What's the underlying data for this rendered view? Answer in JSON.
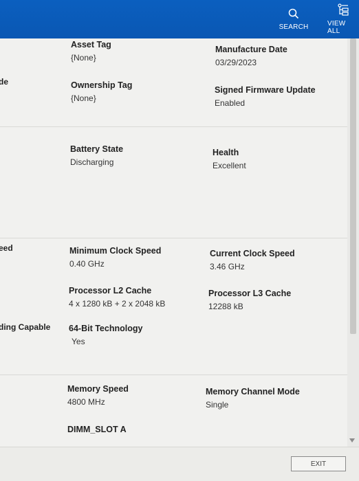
{
  "toolbar": {
    "search_label": "SEARCH",
    "view_all_label": "VIEW ALL"
  },
  "sections": {
    "general": {
      "left_partial": "de",
      "asset_tag": {
        "label": "Asset Tag",
        "value": "{None}"
      },
      "manufacture_date": {
        "label": "Manufacture Date",
        "value": "03/29/2023"
      },
      "ownership_tag": {
        "label": "Ownership Tag",
        "value": "{None}"
      },
      "signed_firmware": {
        "label": "Signed Firmware Update",
        "value": "Enabled"
      }
    },
    "battery": {
      "state": {
        "label": "Battery State",
        "value": "Discharging"
      },
      "health": {
        "label": "Health",
        "value": "Excellent"
      }
    },
    "processor": {
      "left_partial_1": "eed",
      "left_partial_2": "ding Capable",
      "min_clock": {
        "label": "Minimum Clock Speed",
        "value": "0.40 GHz"
      },
      "cur_clock": {
        "label": "Current Clock Speed",
        "value": "3.46 GHz"
      },
      "l2_cache": {
        "label": "Processor L2 Cache",
        "value": "4 x 1280  kB + 2 x 2048  kB"
      },
      "l3_cache": {
        "label": "Processor L3 Cache",
        "value": "12288 kB"
      },
      "bit64": {
        "label": "64-Bit Technology",
        "value": "Yes"
      }
    },
    "memory": {
      "speed": {
        "label": "Memory Speed",
        "value": "4800 MHz"
      },
      "channel_mode": {
        "label": "Memory Channel Mode",
        "value": "Single"
      },
      "dimm_slot_a": {
        "label": "DIMM_SLOT A"
      }
    }
  },
  "footer": {
    "exit_label": "EXIT"
  },
  "colors": {
    "header_bg": "#0a57b3",
    "page_bg": "#f1f1ef"
  }
}
